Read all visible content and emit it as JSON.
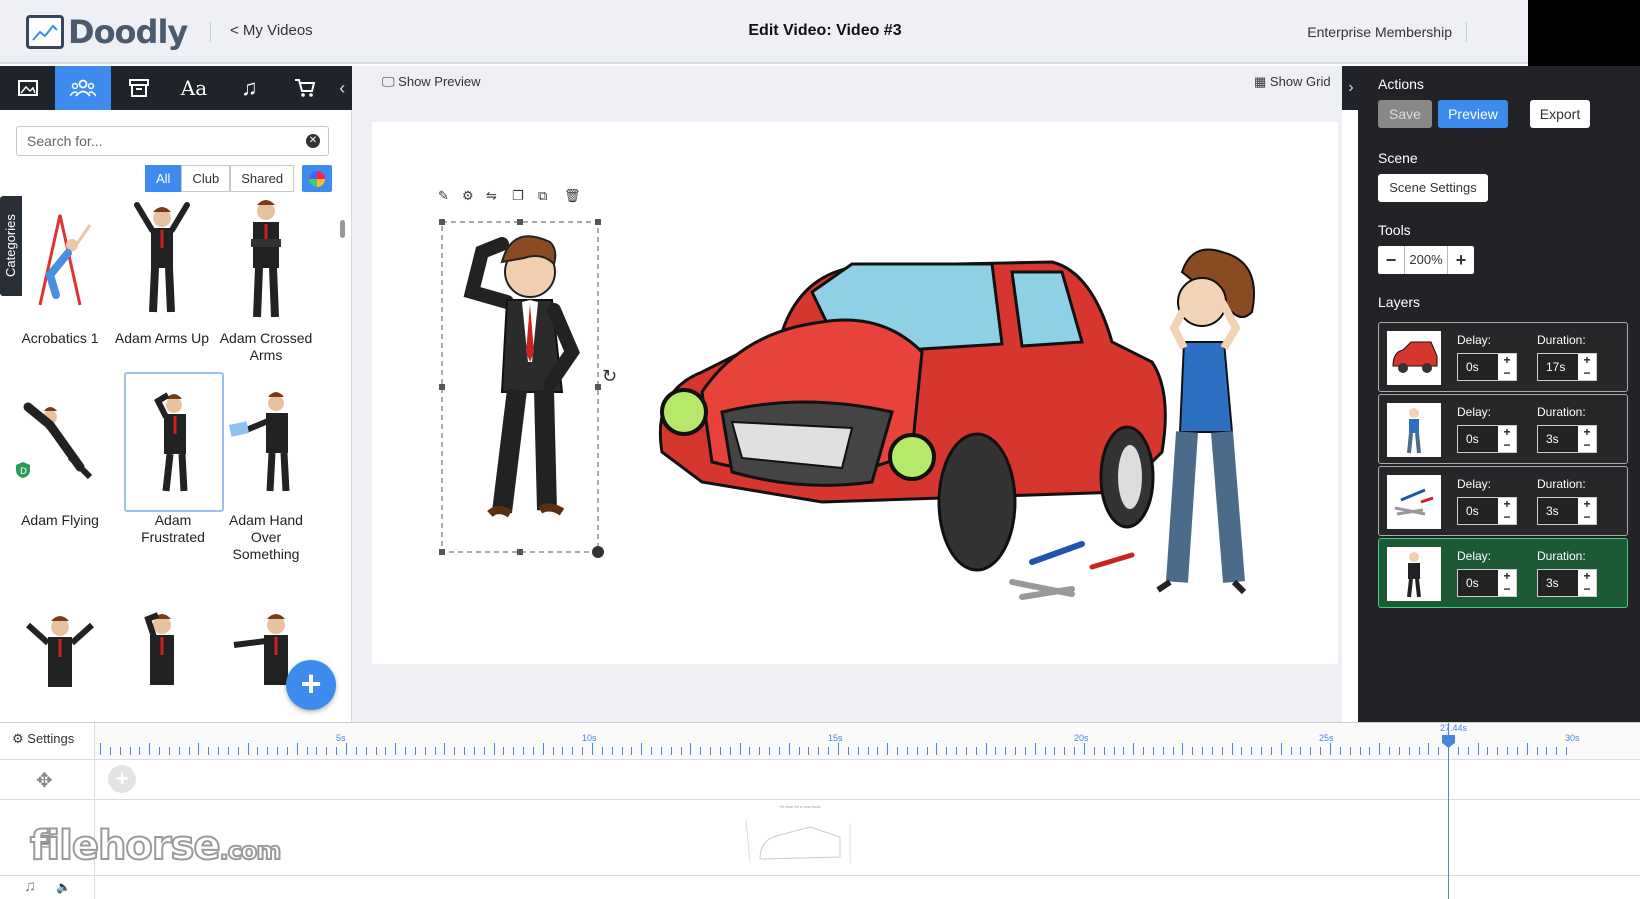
{
  "header": {
    "logo_text": "Doodly",
    "back_link": "< My Videos",
    "title": "Edit Video: Video #3",
    "membership": "Enterprise Membership"
  },
  "left_tabs": [
    {
      "name": "image-icon"
    },
    {
      "name": "characters-icon",
      "active": true
    },
    {
      "name": "props-icon"
    },
    {
      "name": "text-icon"
    },
    {
      "name": "music-icon"
    },
    {
      "name": "cart-icon"
    }
  ],
  "search": {
    "placeholder": "Search for..."
  },
  "filters": {
    "all": "All",
    "club": "Club",
    "shared": "Shared"
  },
  "categories_label": "Categories",
  "assets": [
    {
      "label": "Acrobatics 1"
    },
    {
      "label": "Adam Arms Up"
    },
    {
      "label": "Adam Crossed Arms"
    },
    {
      "label": "Adam Flying"
    },
    {
      "label": "Adam Frustrated",
      "selected": true
    },
    {
      "label": "Adam Hand Over Something"
    }
  ],
  "canvas": {
    "show_preview": "Show Preview",
    "show_grid": "Show Grid"
  },
  "right_panel": {
    "actions_title": "Actions",
    "save": "Save",
    "preview": "Preview",
    "export": "Export",
    "scene_title": "Scene",
    "scene_settings": "Scene Settings",
    "tools_title": "Tools",
    "zoom_minus": "−",
    "zoom_value": "200%",
    "zoom_plus": "+",
    "layers_title": "Layers",
    "delay_label": "Delay:",
    "duration_label": "Duration:",
    "layers": [
      {
        "thumb": "car",
        "delay": "0s",
        "duration": "17s"
      },
      {
        "thumb": "woman",
        "delay": "0s",
        "duration": "3s"
      },
      {
        "thumb": "tools",
        "delay": "0s",
        "duration": "3s"
      },
      {
        "thumb": "man",
        "delay": "0s",
        "duration": "3s",
        "active": true
      }
    ]
  },
  "timeline": {
    "settings": "Settings",
    "labels": [
      "5s",
      "10s",
      "15s",
      "20s",
      "25s",
      "30s"
    ],
    "playhead": "27.44s",
    "scene_caption": "It's time for a new hook"
  },
  "watermark": {
    "main": "filehorse",
    "suffix": ".com"
  },
  "colors": {
    "accent": "#3e8bf0",
    "dark": "#222326",
    "layer_active": "#1b5a35"
  }
}
